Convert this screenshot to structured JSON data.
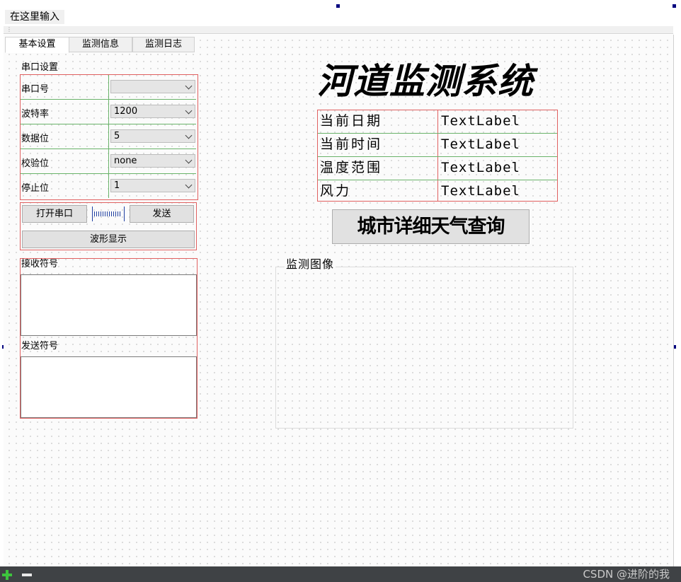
{
  "menubar": {
    "type_here": "在这里输入"
  },
  "tabs": [
    {
      "label": "基本设置",
      "active": true
    },
    {
      "label": "监测信息",
      "active": false
    },
    {
      "label": "监测日志",
      "active": false
    }
  ],
  "serial_settings": {
    "title": "串口设置",
    "rows": [
      {
        "label": "串口号",
        "value": ""
      },
      {
        "label": "波特率",
        "value": "1200"
      },
      {
        "label": "数据位",
        "value": "5"
      },
      {
        "label": "校验位",
        "value": "none"
      },
      {
        "label": "停止位",
        "value": "1"
      }
    ]
  },
  "buttons": {
    "open_serial": "打开串口",
    "send": "发送",
    "waveform": "波形显示"
  },
  "progress": {
    "value_percent": 24
  },
  "receive": {
    "label": "接收符号"
  },
  "send_area": {
    "label": "发送符号"
  },
  "main_title": "河道监测系统",
  "info_table": [
    {
      "label": "当前日期",
      "value": "TextLabel"
    },
    {
      "label": "当前时间",
      "value": "TextLabel"
    },
    {
      "label": "温度范围",
      "value": "TextLabel"
    },
    {
      "label": "风力",
      "value": "TextLabel"
    }
  ],
  "query_button": "城市详细天气查询",
  "monitor_image": {
    "title": "监测图像"
  },
  "watermark": "CSDN @进阶的我",
  "icons": {
    "add": "plus-icon",
    "remove": "minus-icon"
  },
  "colors": {
    "layout_border": "#e06060",
    "grid_line": "#6ab36a",
    "handle": "#00007f"
  }
}
